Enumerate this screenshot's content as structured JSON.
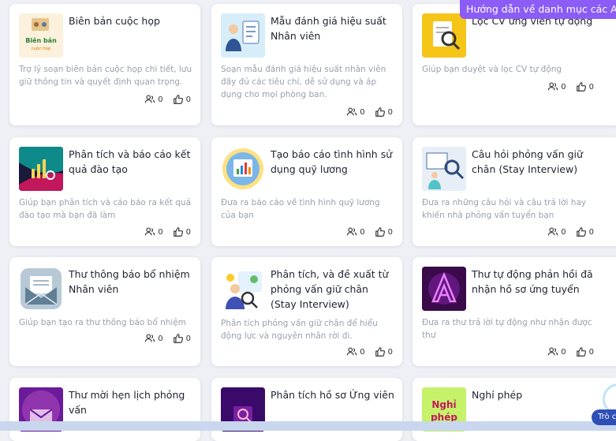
{
  "banner": {
    "text": "Hướng dẫn về danh mục các Ag"
  },
  "chat": {
    "label": "Trò c"
  },
  "cards": [
    {
      "title": "Biên bản cuộc họp",
      "description": "Trợ lý soạn biên bản cuộc họp chi tiết, lưu giữ thông tin và quyết định quan trọng.",
      "users": "0",
      "likes": "0",
      "thumb_text": [
        "Biên bản",
        "cuộc họp"
      ]
    },
    {
      "title": "Mẫu đánh giá hiệu suất Nhân viên",
      "description": "Soạn mẫu đánh giá hiệu suất nhân viên đầy đủ các tiêu chí, dễ sử dụng và áp dụng cho mọi phòng ban.",
      "users": "0",
      "likes": "0"
    },
    {
      "title": "Lọc CV ứng viên tự động",
      "description": "Giúp bạn duyệt và lọc CV tự động",
      "users": "0",
      "likes": "0"
    },
    {
      "title": "Phân tích và báo cáo kết quả đào tạo",
      "description": "Giúp bạn phân tích và cáo báo ra kết quả đào tạo mà bạn đã làm",
      "users": "0",
      "likes": "0"
    },
    {
      "title": "Tạo báo cáo tình hình sử dụng quỹ lương",
      "description": "Đưa ra báo cáo về tình hình quỹ lương của bạn",
      "users": "0",
      "likes": "0"
    },
    {
      "title": "Câu hỏi phỏng vấn giữ chân (Stay Interview)",
      "description": "Đưa ra những câu hỏi và câu trả lời hay khiến nhà phỏng vấn tuyển bạn",
      "users": "0",
      "likes": "0"
    },
    {
      "title": "Thư thông báo bổ nhiệm Nhân viên",
      "description": "Giúp bạn tạo ra thư thông báo bổ nhiệm",
      "users": "0",
      "likes": "0"
    },
    {
      "title": "Phân tích, và đề xuất từ phỏng vấn giữ chân (Stay Interview)",
      "description": "Phân tích phỏng vấn giữ chân để hiểu động lực và nguyên nhân rời đi.",
      "users": "0",
      "likes": "0"
    },
    {
      "title": "Thư tự động phản hồi đã nhận hồ sơ ứng tuyển",
      "description": "Đưa ra thư trả lời tự động như nhận được thư",
      "users": "0",
      "likes": "0"
    },
    {
      "title": "Thư mời hẹn lịch phỏng vấn",
      "description": "",
      "users": "",
      "likes": ""
    },
    {
      "title": "Phân tích hồ sơ Ứng viên",
      "description": "",
      "users": "",
      "likes": ""
    },
    {
      "title": "Nghỉ phép",
      "description": "",
      "users": "",
      "likes": "",
      "thumb_text": [
        "Nghỉ",
        "phép"
      ]
    }
  ]
}
